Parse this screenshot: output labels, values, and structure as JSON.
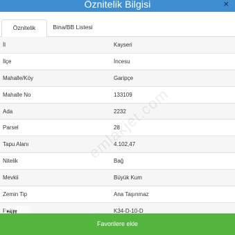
{
  "header": {
    "title": "Öznitelik Bilgisi",
    "close_label": "×"
  },
  "tabs": [
    {
      "label": "Öznitelik Bilgisi"
    },
    {
      "label": "Bina/BB Listesi"
    }
  ],
  "rows": [
    {
      "key": "İl",
      "value": "Kayseri"
    },
    {
      "key": "İlçe",
      "value": "İncesu"
    },
    {
      "key": "Mahalle/Köy",
      "value": "Garipçe"
    },
    {
      "key": "Mahalle No",
      "value": "133109"
    },
    {
      "key": "Ada",
      "value": "2232"
    },
    {
      "key": "Parsel",
      "value": "28"
    },
    {
      "key": "Tapu Alanı",
      "value": "4.102,47"
    },
    {
      "key": "Nitelik",
      "value": "Bağ"
    },
    {
      "key": "Mevkii",
      "value": "Büyük Kum"
    },
    {
      "key": "Zemin Tip",
      "value": "Ana Taşınmaz"
    },
    {
      "key": "Pafta",
      "value": "K34-D-10-D"
    }
  ],
  "watermark": "emlakjet.com",
  "logo": {
    "text": "stt"
  },
  "footer": {
    "button_label": "Favorilere ekle"
  },
  "colors": {
    "header": "#3d8fd1",
    "footer_button": "#53b53e"
  }
}
